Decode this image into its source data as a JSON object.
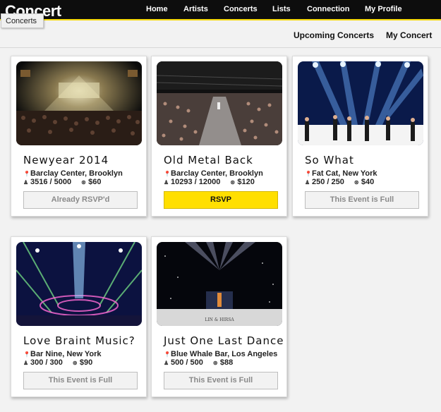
{
  "brand": "Concert",
  "nav": [
    "Home",
    "Artists",
    "Concerts",
    "Lists",
    "Connection",
    "My Profile"
  ],
  "tooltip": "Concerts",
  "subnav": [
    "Upcoming Concerts",
    "My Concert"
  ],
  "concerts": [
    {
      "title": "Newyear 2014",
      "location": "Barclay Center, Brooklyn",
      "attendance": "3516 / 5000",
      "price": "$60",
      "button": "Already RSVP'd"
    },
    {
      "title": "Old Metal Back",
      "location": "Barclay Center, Brooklyn",
      "attendance": "10293 / 12000",
      "price": "$120",
      "button": "RSVP"
    },
    {
      "title": "So What",
      "location": "Fat Cat, New York",
      "attendance": "250 / 250",
      "price": "$40",
      "button": "This Event is Full"
    },
    {
      "title": "Love Braint Music?",
      "location": "Bar Nine, New York",
      "attendance": "300 / 300",
      "price": "$90",
      "button": "This Event is Full"
    },
    {
      "title": "Just One Last Dance",
      "location": "Blue Whale Bar, Los Angeles",
      "attendance": "500 / 500",
      "price": "$88",
      "button": "This Event is Full"
    }
  ],
  "photo_caption": "LIN & HIRSA",
  "colors": {
    "accent": "#ffdf00",
    "topbar": "#0d0d0d"
  }
}
